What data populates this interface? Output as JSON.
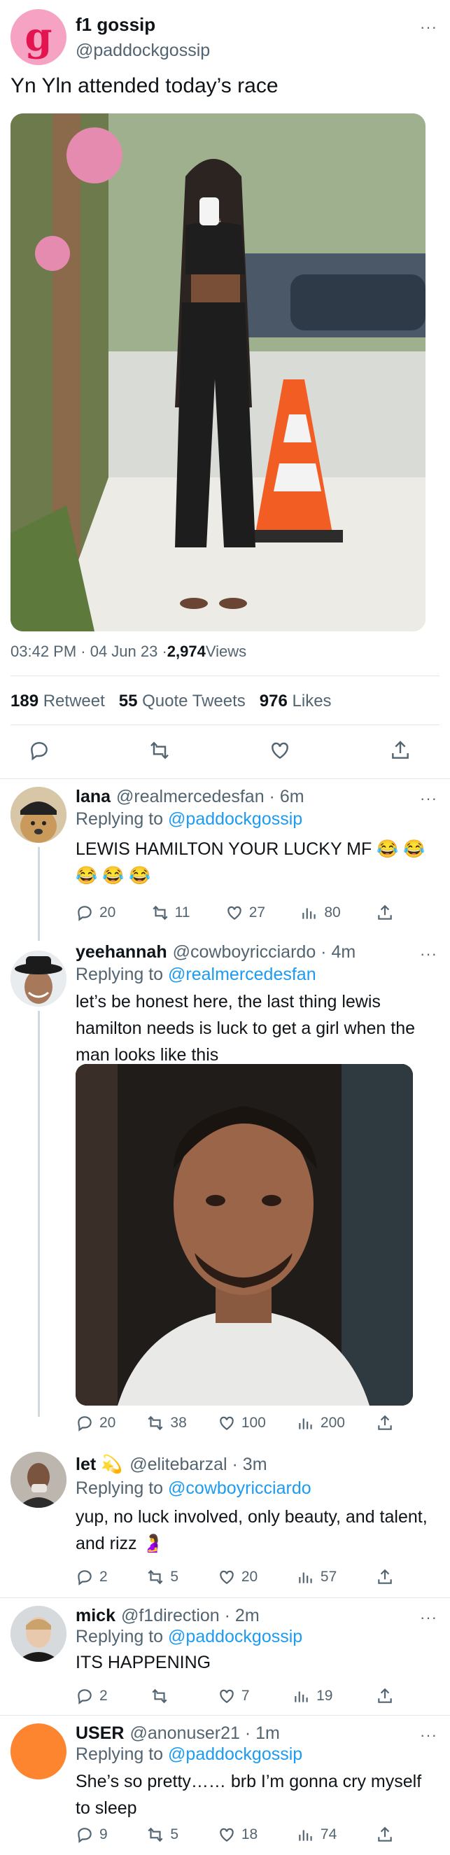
{
  "main_tweet": {
    "author_name": "f1 gossip",
    "author_handle": "@paddockgossip",
    "avatar_letter": "g",
    "text": "Yn Yln attended today’s race",
    "time": "03:42 PM · 04 Jun 23 · ",
    "views_count": "2,974",
    "views_label": " Views",
    "retweets_count": "189",
    "retweets_label": "Retweet",
    "quotes_count": "55",
    "quotes_label": "Quote Tweets",
    "likes_count": "976",
    "likes_label": "Likes"
  },
  "replies": [
    {
      "name": "lana",
      "handle": "@realmercedesfan · 6m",
      "replying_label": "Replying to ",
      "replying_to": "@paddockgossip",
      "text": "LEWIS HAMILTON YOUR LUCKY MF 😂 😂 😂 😂 😂",
      "replies": "20",
      "retweets": "11",
      "likes": "27",
      "views": "80"
    },
    {
      "name": "yeehannah",
      "handle": "@cowboyricciardo · 4m",
      "replying_label": "Replying to ",
      "replying_to": "@realmercedesfan",
      "text": "let’s be honest here, the last thing lewis hamilton needs is luck to get a girl when the man looks like this",
      "replies": "20",
      "retweets": "38",
      "likes": "100",
      "views": "200"
    },
    {
      "name": "let 💫",
      "handle": "@elitebarzal · 3m",
      "replying_label": "Replying to ",
      "replying_to": "@cowboyricciardo",
      "text": "yup, no luck involved, only beauty, and talent, and rizz 🤰",
      "replies": "2",
      "retweets": "5",
      "likes": "20",
      "views": "57"
    },
    {
      "name": "mick",
      "handle": "@f1direction · 2m",
      "replying_label": "Replying to ",
      "replying_to": "@paddockgossip",
      "text": "ITS HAPPENING",
      "replies": "2",
      "retweets": "",
      "likes": "7",
      "views": "19"
    },
    {
      "name": "USER",
      "handle": "@anonuser21 · 1m",
      "replying_label": "Replying to ",
      "replying_to": "@paddockgossip",
      "text": "She’s so pretty…… brb I’m gonna cry myself to sleep",
      "replies": "9",
      "retweets": "5",
      "likes": "18",
      "views": "74"
    }
  ],
  "colors": {
    "accent": "#1d9bf0",
    "brand_pink": "#f0528a",
    "text": "#0f1419",
    "secondary": "#536471",
    "orange_avatar": "#fd8530"
  },
  "icons": [
    "more-icon",
    "reply-icon",
    "retweet-icon",
    "like-icon",
    "share-icon",
    "views-icon"
  ]
}
